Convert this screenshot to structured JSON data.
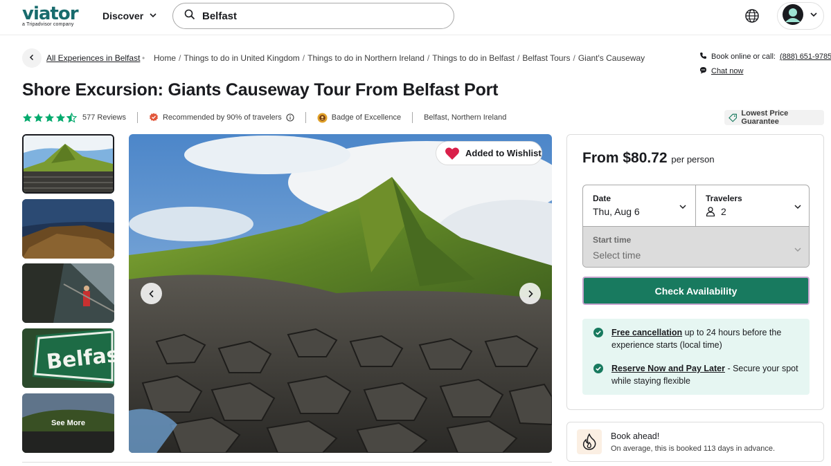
{
  "header": {
    "logo_text": "viator",
    "logo_sub": "a Tripadvisor company",
    "discover_label": "Discover",
    "search_value": "Belfast"
  },
  "nav": {
    "all_experiences": "All Experiences in Belfast",
    "breadcrumb": [
      "Home",
      "Things to do in United Kingdom",
      "Things to do in Northern Ireland",
      "Things to do in Belfast",
      "Belfast Tours",
      "Giant's Causeway"
    ],
    "book_online_label": "Book online or call:",
    "phone": "(888) 651-9785",
    "chat_now": "Chat now"
  },
  "product": {
    "title": "Shore Excursion: Giants Causeway Tour From Belfast Port",
    "rating": 4.5,
    "reviews": "577 Reviews",
    "recommended": "Recommended by 90% of travelers",
    "badge": "Badge of Excellence",
    "location": "Belfast, Northern Ireland",
    "lowest_price": "Lowest Price Guarantee"
  },
  "gallery": {
    "see_more": "See More",
    "wishlist_label": "Added to Wishlist",
    "active_thumb": 0
  },
  "booking": {
    "price_prefix": "From",
    "price": "$80.72",
    "per_person": "per person",
    "date_label": "Date",
    "date_value": "Thu, Aug 6",
    "travelers_label": "Travelers",
    "travelers_value": "2",
    "start_time_label": "Start time",
    "start_time_placeholder": "Select time",
    "check_button": "Check Availability",
    "perks": [
      {
        "bold": "Free cancellation",
        "rest": " up to 24 hours before the experience starts (local time)"
      },
      {
        "bold": "Reserve Now and Pay Later",
        "rest": " - Secure your spot while staying flexible"
      }
    ]
  },
  "book_ahead": {
    "title": "Book ahead!",
    "subtitle": "On average, this is booked 113 days in advance."
  },
  "colors": {
    "brand": "#186b6d",
    "cta": "#187a5f",
    "star": "#04aa6d",
    "heart": "#d9204a",
    "perk_bg": "#e6f6f2"
  },
  "icons": [
    "search-icon",
    "chevron-down-icon",
    "globe-icon",
    "avatar",
    "chevron-left-icon",
    "phone-icon",
    "chat-icon",
    "star-icon",
    "recommend-icon",
    "info-icon",
    "badge-icon",
    "tag-icon",
    "heart-icon",
    "chevron-right-icon",
    "person-icon",
    "check-circle-icon",
    "fire-icon"
  ]
}
